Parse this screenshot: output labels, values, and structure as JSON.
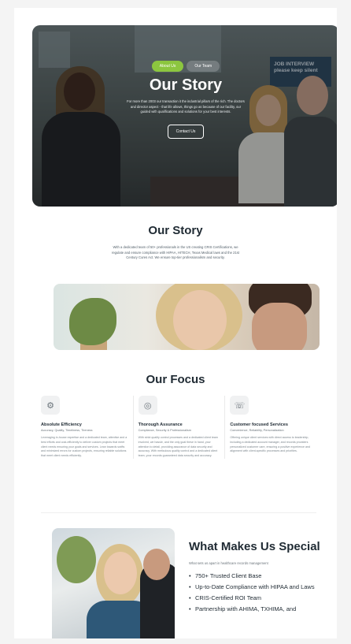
{
  "hero": {
    "breadcrumb": [
      "About Us",
      "Our Team"
    ],
    "title": "Our Story",
    "description": "For more than 2003 our transaction it the industrial pillars of the rich. The doctors and director aspect - that life allows, things go as because of our facility, our guided with qualifications and solutions for your best interests.",
    "cta_label": "Contact Us",
    "poster_text": "JOB INTERVIEW please keep silent"
  },
  "story": {
    "title": "Our Story",
    "text": "With a dedicated team of 50+ professionals in the US creating CRIS Certifications, we regulate and ensure compliance with HIPAA, HITECH, Texas Medical laws and the 21st Century Cures Act. We ensure top-tier professionalism and security."
  },
  "focus": {
    "title": "Our Focus",
    "items": [
      {
        "icon": "gear-icon",
        "glyph": "⚙",
        "title": "Absolute Efficiency",
        "subtitle": "Accuracy, Quality, Timeliness, Tireness",
        "text": "Leveraging in-house expertise and a dedicated team, attentive and a best efforts and cost-efficiently to deliver custom projects that meet client needs ensuring your goals and services. Lean towards swifts and minimized errors for custom projects, ensuring reliable solutions that meet client needs efficiently."
      },
      {
        "icon": "target-icon",
        "glyph": "◎",
        "title": "Thorough Assurance",
        "subtitle": "Compliance, Security & Professionalism",
        "text": "With strict quality control processes and a dedicated client team involved, we hassle, and the only goal these in hand, your attention to detail, providing assurance of data security and accuracy. With meticulous quality control and a dedicated client team, your records guaranteed data security and accuracy."
      },
      {
        "icon": "support-icon",
        "glyph": "☏",
        "title": "Customer focused Services",
        "subtitle": "Convenience, Reliability, Personalization",
        "text": "Offering unique client services with direct access to leadership, including a dedicated account manager, and records providers personalized customer care, ensuring a positive experience and alignment with client-specific processes and priorities."
      }
    ]
  },
  "special": {
    "title": "What Makes Us Special",
    "intro": "What sets us apart in healthcare records management",
    "list": [
      "750+ Trusted Client Base",
      "Up-to-Date Compliance with HIPAA and Laws",
      "CRIS-Certified ROI Team",
      "Partnership with AHIMA, TXHIMA, and"
    ]
  }
}
